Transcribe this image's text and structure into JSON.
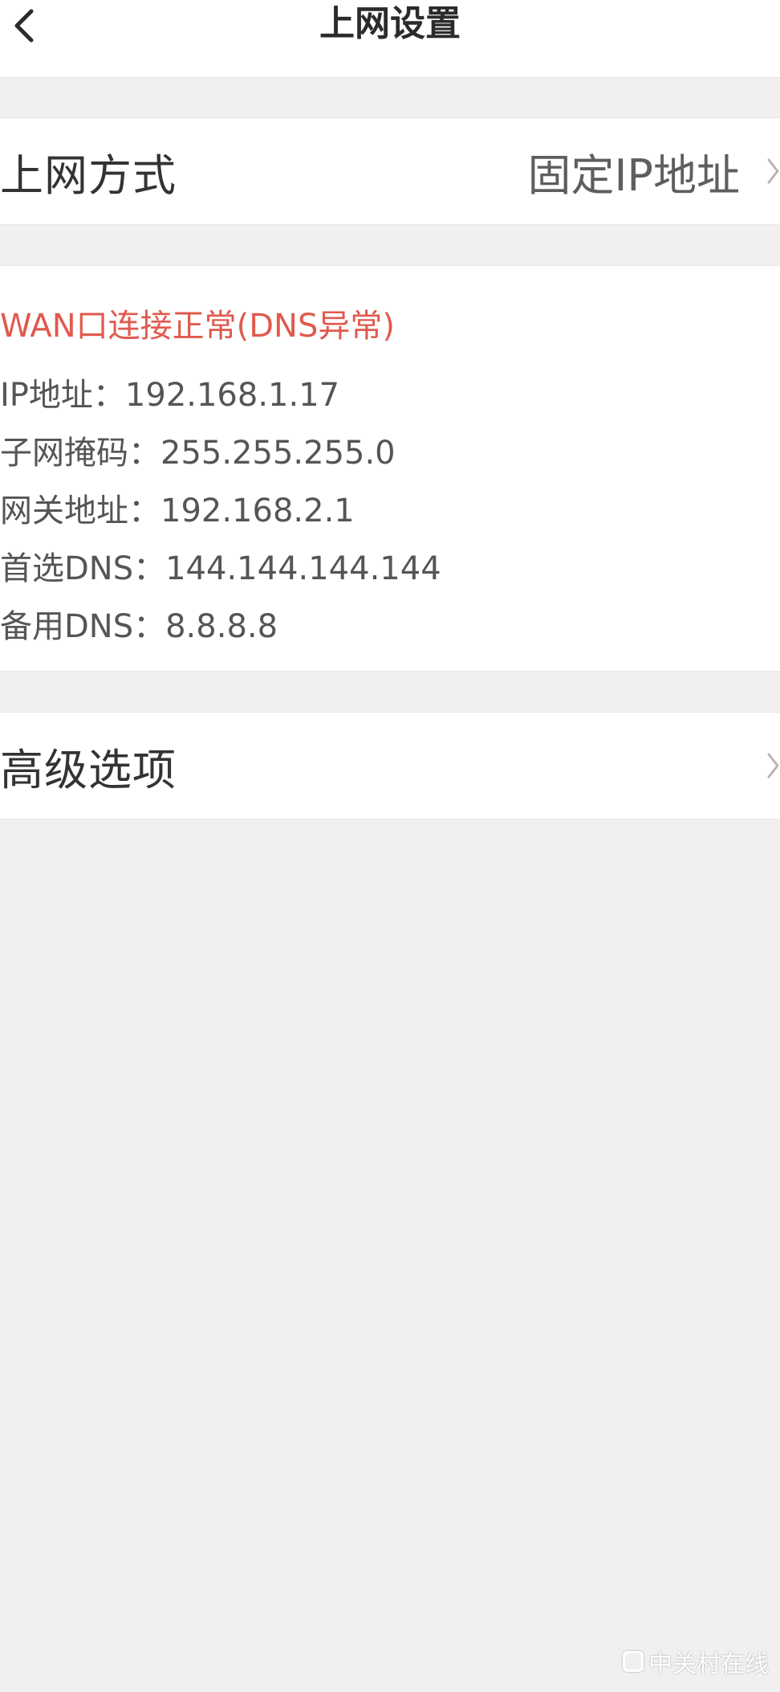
{
  "header": {
    "title": "上网设置",
    "back_icon": "chevron-left-icon"
  },
  "connection_mode": {
    "label": "上网方式",
    "value": "固定IP地址",
    "icon": "chevron-right-icon"
  },
  "status": {
    "title": "WAN口连接正常(DNS异常)",
    "title_color": "#e05a4e",
    "ip": "IP地址：192.168.1.17",
    "subnet_mask": "子网掩码：255.255.255.0",
    "gateway": "网关地址：192.168.2.1",
    "primary_dns": "首选DNS：144.144.144.144",
    "secondary_dns": "备用DNS：8.8.8.8"
  },
  "advanced": {
    "label": "高级选项",
    "icon": "chevron-right-icon"
  },
  "watermark": {
    "text": "中关村在线"
  }
}
